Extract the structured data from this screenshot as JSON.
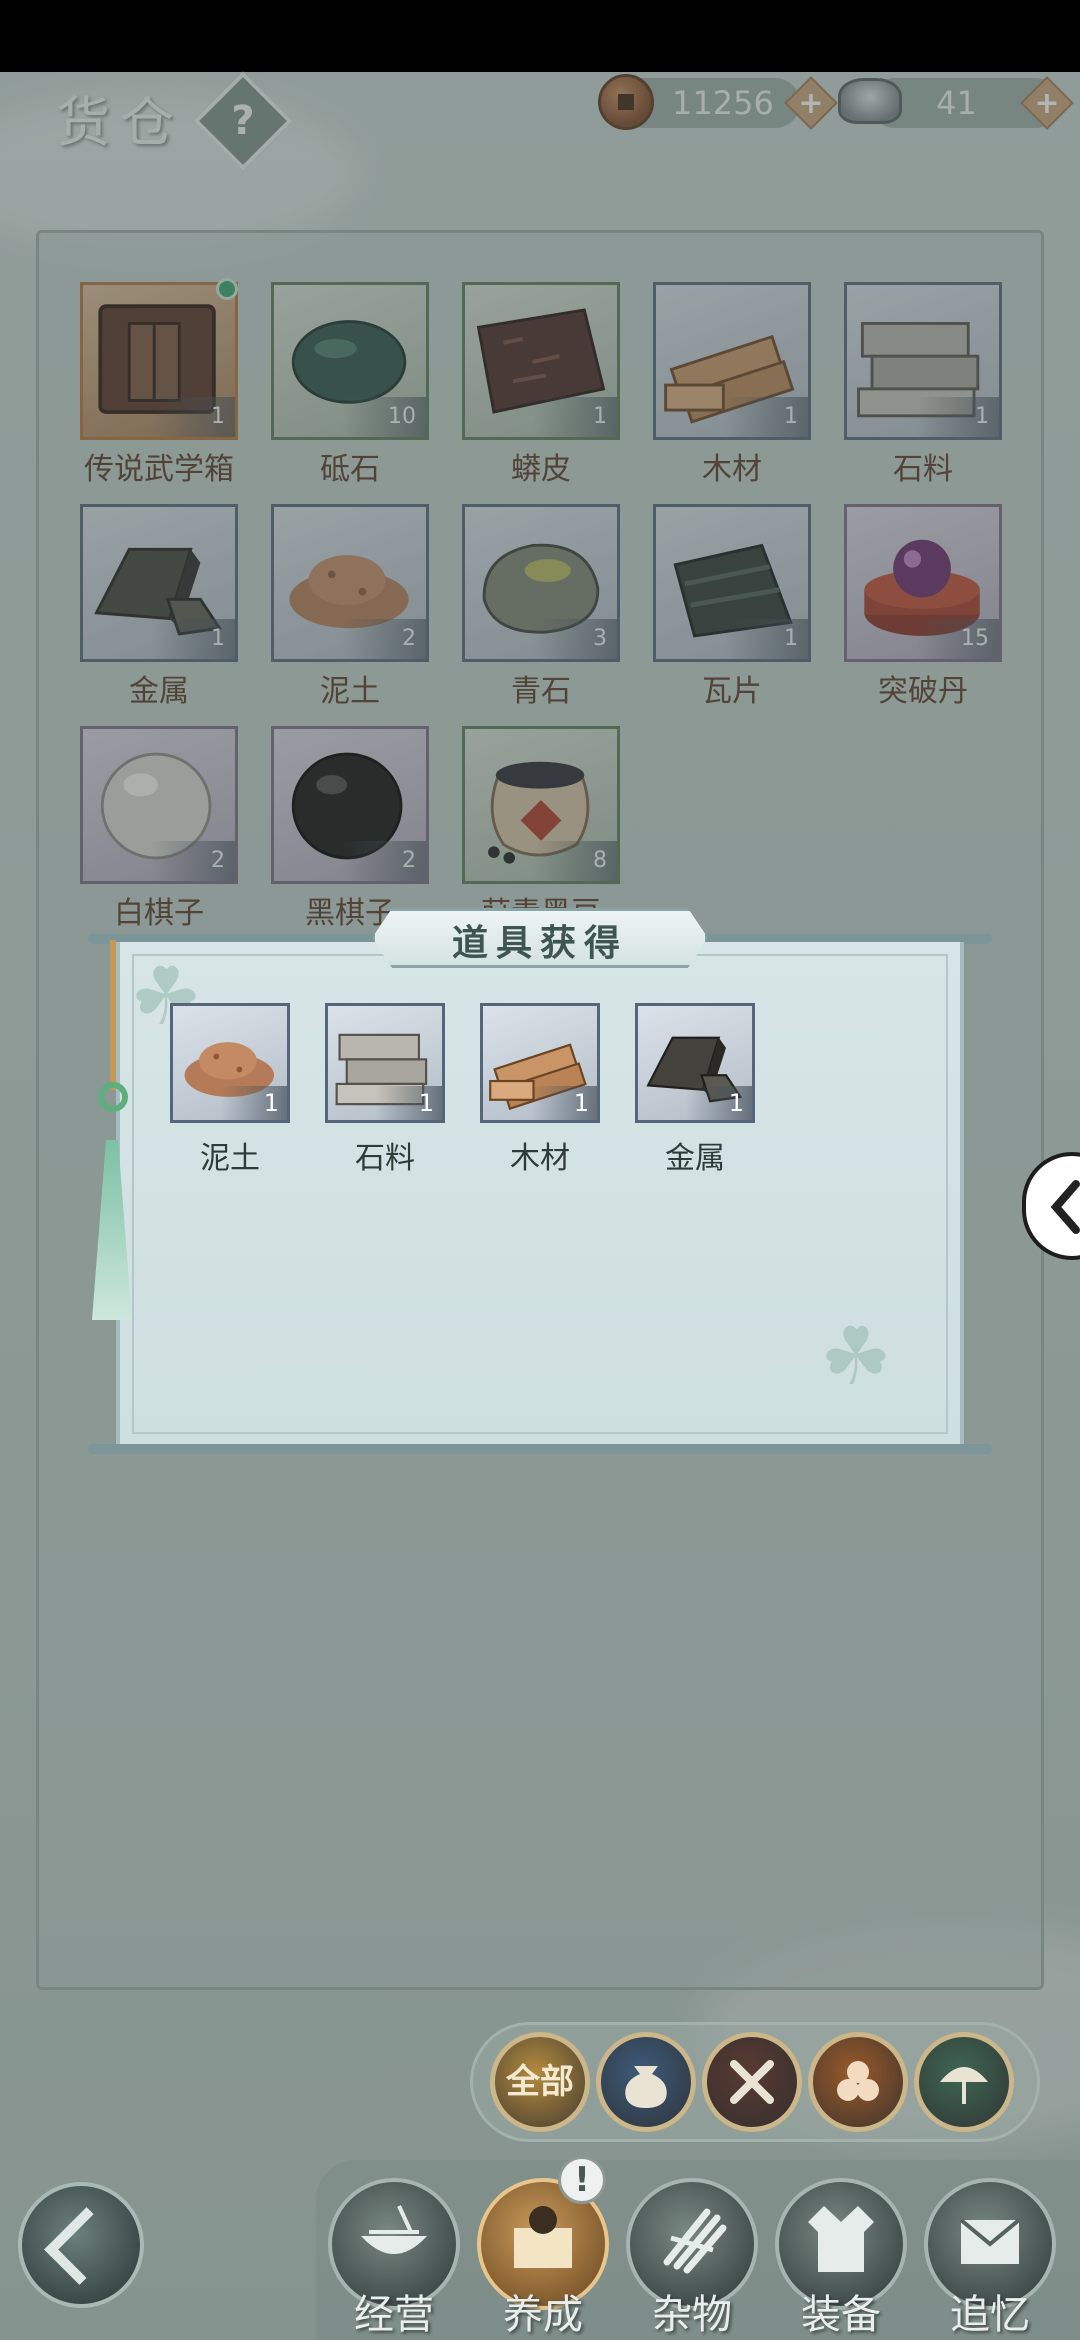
{
  "header": {
    "title": "货仓",
    "help": "?"
  },
  "currency": {
    "copper": {
      "icon": "copper-coin-icon",
      "value": "11256",
      "plus": "+"
    },
    "silver": {
      "icon": "silver-ingot-icon",
      "value": "41",
      "plus": "+"
    }
  },
  "inventory": {
    "items": [
      {
        "label": "传说武学箱",
        "count": "1",
        "icon": "legend-chest-icon",
        "rarity": "orange",
        "new": true
      },
      {
        "label": "砥石",
        "count": "10",
        "icon": "whetstone-icon",
        "rarity": "green"
      },
      {
        "label": "蟒皮",
        "count": "1",
        "icon": "python-skin-icon",
        "rarity": "green"
      },
      {
        "label": "木材",
        "count": "1",
        "icon": "lumber-icon",
        "rarity": "blue"
      },
      {
        "label": "石料",
        "count": "1",
        "icon": "stone-block-icon",
        "rarity": "blue"
      },
      {
        "label": "金属",
        "count": "1",
        "icon": "metal-ingot-icon",
        "rarity": "blue"
      },
      {
        "label": "泥土",
        "count": "2",
        "icon": "soil-pile-icon",
        "rarity": "blue"
      },
      {
        "label": "青石",
        "count": "3",
        "icon": "bluestone-icon",
        "rarity": "blue"
      },
      {
        "label": "瓦片",
        "count": "1",
        "icon": "roof-tile-icon",
        "rarity": "blue"
      },
      {
        "label": "突破丹",
        "count": "15",
        "icon": "breakthrough-pill-icon",
        "rarity": "purple"
      },
      {
        "label": "白棋子",
        "count": "2",
        "icon": "white-go-stone-icon",
        "rarity": "purple"
      },
      {
        "label": "黑棋子",
        "count": "2",
        "icon": "black-go-stone-icon",
        "rarity": "purple"
      },
      {
        "label": "莳青黑豆",
        "count": "8",
        "icon": "black-bean-jar-icon",
        "rarity": "green"
      }
    ]
  },
  "popup": {
    "title": "道具获得",
    "items": [
      {
        "label": "泥土",
        "count": "1",
        "icon": "soil-pile-icon"
      },
      {
        "label": "石料",
        "count": "1",
        "icon": "stone-block-icon"
      },
      {
        "label": "木材",
        "count": "1",
        "icon": "lumber-icon"
      },
      {
        "label": "金属",
        "count": "1",
        "icon": "metal-ingot-icon"
      }
    ]
  },
  "filters": [
    {
      "name": "全部",
      "icon": "all-filter-icon",
      "color": "#b58b3f"
    },
    {
      "name": "",
      "icon": "pouch-icon",
      "color": "#3d5a7a"
    },
    {
      "name": "",
      "icon": "tools-icon",
      "color": "#5a3a33"
    },
    {
      "name": "",
      "icon": "logs-icon",
      "color": "#9a5a2b"
    },
    {
      "name": "",
      "icon": "umbrella-icon",
      "color": "#3f6654"
    }
  ],
  "nav": [
    {
      "label": "经营",
      "icon": "bowl-icon"
    },
    {
      "label": "养成",
      "icon": "gift-box-icon",
      "active": true,
      "badge": "!"
    },
    {
      "label": "杂物",
      "icon": "bundle-icon"
    },
    {
      "label": "装备",
      "icon": "robe-icon"
    },
    {
      "label": "追忆",
      "icon": "letter-icon"
    }
  ],
  "colors": {
    "accent": "#c9a17a",
    "rarity_orange": "#b5743f",
    "rarity_blue": "#55667a",
    "rarity_green": "#5d7a5a",
    "rarity_purple": "#7a6b86"
  }
}
